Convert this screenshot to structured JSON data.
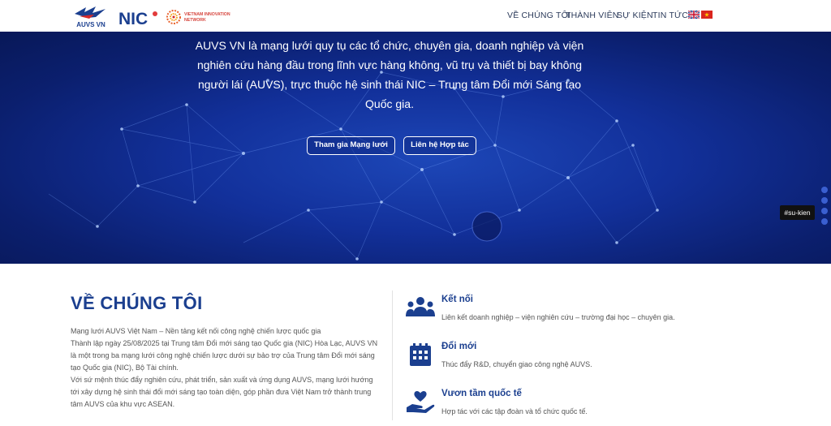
{
  "header": {
    "logos": {
      "auvs": "AUVS VN",
      "nic": "NIC",
      "vin_line1": "VIETNAM INNOVATION",
      "vin_line2": "NETWORK"
    },
    "nav": [
      "VỀ CHÚNG TÔI",
      "THÀNH VIÊN",
      "SỰ KIỆN",
      "TIN TỨC"
    ],
    "flags": [
      "uk-flag-icon",
      "vn-flag-icon"
    ]
  },
  "hero": {
    "intro": "AUVS VN là mạng lưới quy tụ các tổ chức, chuyên gia, doanh nghiệp và viện nghiên cứu hàng đầu trong lĩnh vực hàng không, vũ trụ và thiết bị bay không người lái (AUVS), trực thuộc hệ sinh thái NIC – Trung tâm Đổi mới Sáng tạo Quốc gia.",
    "buttons": {
      "join": "Tham gia Mạng lưới",
      "contact": "Liên hệ Hợp tác"
    },
    "tag": "#su-kien"
  },
  "about": {
    "title": "VỀ CHÚNG TÔI",
    "paragraphs": [
      "Mạng lưới AUVS Việt Nam – Nền tảng kết nối công nghệ chiến lược quốc gia",
      "Thành lập ngày 25/08/2025 tại Trung tâm Đổi mới sáng tạo Quốc gia (NIC) Hòa Lạc, AUVS VN là một trong ba mạng lưới công nghệ chiến lược dưới sự bảo trợ của Trung tâm Đổi mới sáng tạo Quốc gia (NIC), Bộ Tài chính.",
      "Với sứ mệnh thúc đẩy nghiên cứu, phát triển, sản xuất và ứng dụng AUVS, mạng lưới hướng tới xây dựng hệ sinh thái đổi mới sáng tạo toàn diện, góp phần đưa Việt Nam trở thành trung tâm AUVS của khu vực ASEAN."
    ],
    "features": [
      {
        "title": "Kết nối",
        "desc": "Liên kết doanh nghiệp – viện nghiên cứu – trường đại học – chuyên gia.",
        "icon": "people-icon"
      },
      {
        "title": "Đổi mới",
        "desc": "Thúc đẩy R&D, chuyển giao công nghệ AUVS.",
        "icon": "building-icon"
      },
      {
        "title": "Vươn tầm quốc tế",
        "desc": "Hợp tác với các tập đoàn và tổ chức quốc tế.",
        "icon": "hand-heart-icon"
      }
    ]
  },
  "colors": {
    "primary": "#1b3f8f",
    "hero_dark": "#0b1f6e",
    "hero_light": "#1d47b8",
    "text": "#555555"
  }
}
